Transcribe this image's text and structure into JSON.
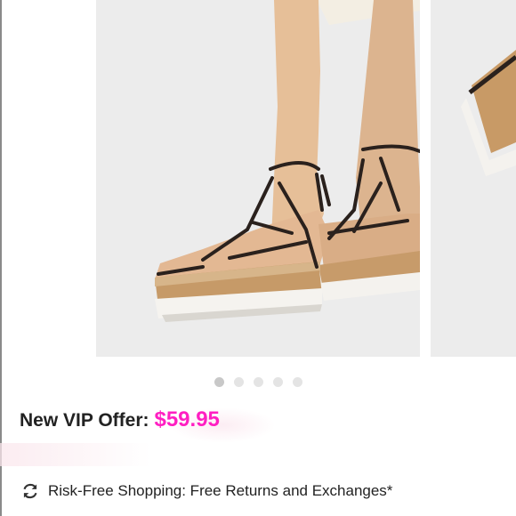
{
  "carousel": {
    "image_alt": "Black lace-up platform espadrille sandal with cork wedge sole",
    "dot_count": 5,
    "active_index": 0
  },
  "offer": {
    "label": "New VIP Offer:",
    "price": "$59.95",
    "price_color": "#ff1fc2"
  },
  "policy": {
    "icon": "refresh-icon",
    "text": "Risk-Free Shopping: Free Returns and Exchanges*"
  }
}
